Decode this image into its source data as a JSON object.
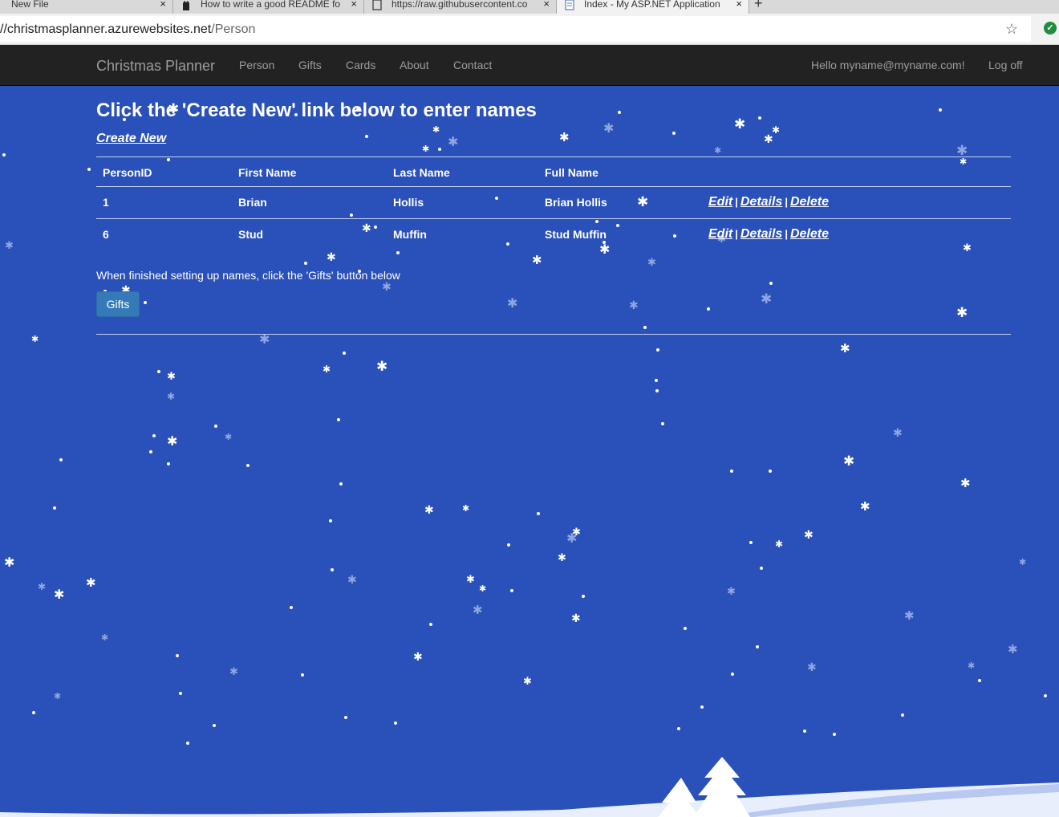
{
  "browser": {
    "tabs": [
      {
        "label": "New File",
        "active": false
      },
      {
        "label": "How to write a good README fo",
        "active": false
      },
      {
        "label": "https://raw.githubusercontent.co",
        "active": false
      },
      {
        "label": "Index - My ASP.NET Application",
        "active": true
      }
    ],
    "close_glyph": "×",
    "new_tab_glyph": "+",
    "url_host": "//christmasplanner.azurewebsites.net",
    "url_path": "/Person",
    "bookmark_glyph": "☆",
    "extension_glyph": "✓",
    "extension_color": "#1e8e3e"
  },
  "navbar": {
    "brand": "Christmas Planner",
    "links": [
      "Person",
      "Gifts",
      "Cards",
      "About",
      "Contact"
    ],
    "greeting": "Hello myname@myname.com!",
    "logoff": "Log off",
    "background": "#222222",
    "link_color": "#9d9d9d"
  },
  "page": {
    "title": "Click the 'Create New' link below to enter names",
    "create_new": "Create New",
    "table": {
      "headers": [
        "PersonID",
        "First Name",
        "Last Name",
        "Full Name"
      ],
      "rows": [
        {
          "id": "1",
          "first": "Brian",
          "last": "Hollis",
          "full": "Brian Hollis"
        },
        {
          "id": "6",
          "first": "Stud",
          "last": "Muffin",
          "full": "Stud Muffin"
        }
      ],
      "actions": {
        "edit": "Edit",
        "details": "Details",
        "delete": "Delete",
        "separator": "|"
      }
    },
    "instructions": "When finished setting up names, click the 'Gifts' button below",
    "gifts_button": "Gifts",
    "background_color": "#2a50b9",
    "button_color": "#337ab7"
  }
}
